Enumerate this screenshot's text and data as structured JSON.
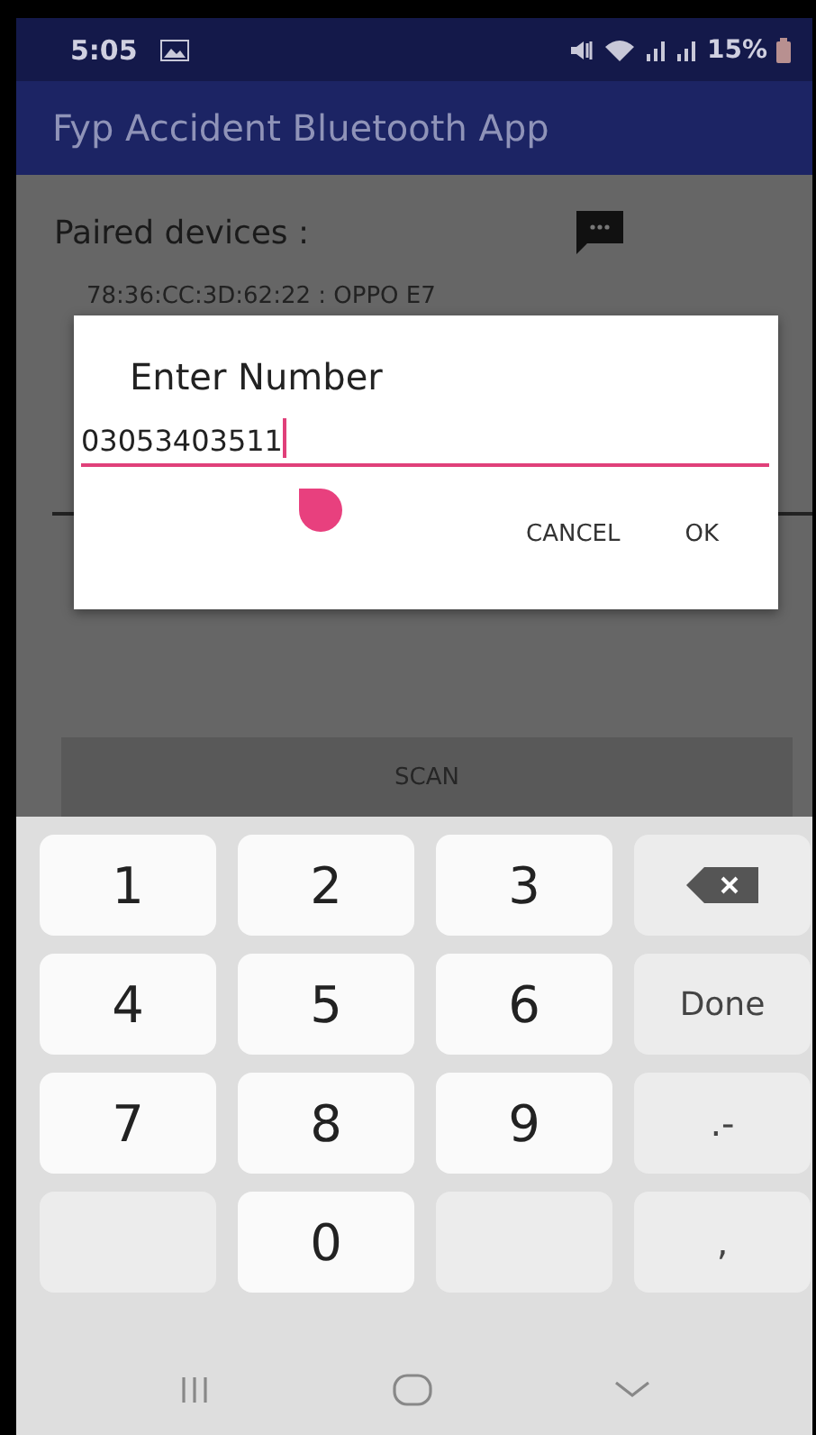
{
  "status_bar": {
    "time": "5:05",
    "battery": "15%"
  },
  "app_bar": {
    "title": "Fyp Accident Bluetooth App"
  },
  "paired_label": "Paired devices :",
  "devices": [
    "78:36:CC:3D:62:22 : OPPO E7"
  ],
  "scan_button": "SCAN",
  "dialog": {
    "title": "Enter Number",
    "value": "03053403511",
    "buttons": [
      "CANCEL",
      "OK"
    ]
  },
  "keyboard": {
    "keys": [
      {
        "kind": "digit",
        "label": "1"
      },
      {
        "kind": "digit",
        "label": "2"
      },
      {
        "kind": "digit",
        "label": "3"
      },
      {
        "kind": "backspace"
      },
      {
        "kind": "digit",
        "label": "4"
      },
      {
        "kind": "digit",
        "label": "5"
      },
      {
        "kind": "digit",
        "label": "6"
      },
      {
        "kind": "function",
        "label": "Done"
      },
      {
        "kind": "digit",
        "label": "7"
      },
      {
        "kind": "digit",
        "label": "8"
      },
      {
        "kind": "digit",
        "label": "9"
      },
      {
        "kind": "function",
        "label": ".-"
      },
      {
        "kind": "blank"
      },
      {
        "kind": "digit",
        "label": "0"
      },
      {
        "kind": "blank"
      },
      {
        "kind": "function",
        "label": ","
      }
    ]
  }
}
